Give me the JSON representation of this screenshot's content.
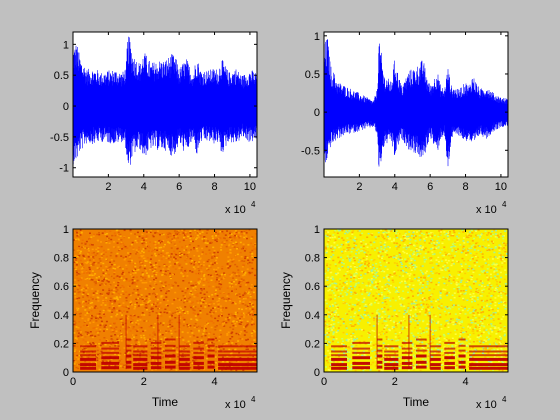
{
  "figure": {
    "background": "#c0c0c0"
  },
  "chart_data": [
    {
      "id": "waveform-top-left",
      "type": "line",
      "title": "",
      "xlabel": "",
      "ylabel": "",
      "xlim": [
        0,
        104000
      ],
      "ylim": [
        -1.15,
        1.2
      ],
      "xticks": [
        20000,
        40000,
        60000,
        80000,
        100000
      ],
      "xtick_labels": [
        "2",
        "4",
        "6",
        "8",
        "10"
      ],
      "x_exponent_label": "x 10",
      "x_exponent_power": "4",
      "yticks": [
        1,
        0.5,
        0,
        -0.5,
        -1
      ],
      "ytick_labels": [
        "1",
        "0.5",
        "0",
        "-0.5",
        "-1"
      ],
      "series": [
        {
          "color": "#0000ff",
          "envelope_x": [
            0,
            2000,
            4000,
            8000,
            12000,
            16000,
            20000,
            24000,
            28000,
            30000,
            31000,
            32000,
            34000,
            38000,
            40000,
            42000,
            44000,
            48000,
            52000,
            56000,
            58000,
            60000,
            62000,
            64000,
            66000,
            68000,
            70000,
            72000,
            76000,
            80000,
            82000,
            84000,
            88000,
            92000,
            96000,
            100000,
            104000
          ],
          "envelope_top": [
            0.95,
            1.05,
            0.8,
            0.6,
            0.62,
            0.55,
            0.58,
            0.6,
            0.55,
            0.65,
            1.2,
            1.1,
            0.85,
            0.7,
            0.9,
            0.8,
            0.7,
            0.75,
            0.75,
            0.85,
            0.8,
            0.6,
            0.7,
            0.78,
            0.65,
            0.55,
            0.85,
            0.6,
            0.58,
            0.62,
            0.6,
            0.78,
            0.55,
            0.62,
            0.5,
            0.6,
            0.55
          ],
          "envelope_bottom": [
            -0.95,
            -0.9,
            -0.75,
            -0.6,
            -0.62,
            -0.58,
            -0.6,
            -0.62,
            -0.58,
            -0.7,
            -1.15,
            -1.0,
            -0.8,
            -0.7,
            -0.85,
            -0.78,
            -0.7,
            -0.72,
            -0.72,
            -0.82,
            -0.78,
            -0.6,
            -0.72,
            -0.78,
            -0.65,
            -0.58,
            -0.82,
            -0.6,
            -0.58,
            -0.62,
            -0.6,
            -0.8,
            -0.58,
            -0.62,
            -0.52,
            -0.6,
            -0.55
          ]
        }
      ]
    },
    {
      "id": "waveform-top-right",
      "type": "line",
      "title": "",
      "xlabel": "",
      "ylabel": "",
      "xlim": [
        0,
        104000
      ],
      "ylim": [
        -0.85,
        1.05
      ],
      "xticks": [
        20000,
        40000,
        60000,
        80000,
        100000
      ],
      "xtick_labels": [
        "2",
        "4",
        "6",
        "8",
        "10"
      ],
      "x_exponent_label": "x 10",
      "x_exponent_power": "4",
      "yticks": [
        1,
        0.5,
        0,
        -0.5
      ],
      "ytick_labels": [
        "1",
        "0.5",
        "0",
        "-0.5"
      ],
      "series": [
        {
          "color": "#0000ff",
          "envelope_x": [
            0,
            2000,
            4000,
            8000,
            12000,
            16000,
            20000,
            24000,
            28000,
            30000,
            31000,
            32000,
            34000,
            38000,
            40000,
            42000,
            44000,
            48000,
            52000,
            56000,
            58000,
            60000,
            62000,
            64000,
            66000,
            68000,
            70000,
            72000,
            76000,
            80000,
            82000,
            84000,
            88000,
            92000,
            96000,
            100000,
            104000
          ],
          "envelope_top": [
            0.9,
            1.0,
            0.6,
            0.4,
            0.35,
            0.3,
            0.25,
            0.2,
            0.15,
            0.3,
            0.95,
            0.85,
            0.5,
            0.4,
            0.72,
            0.5,
            0.35,
            0.55,
            0.6,
            0.7,
            0.5,
            0.35,
            0.45,
            0.55,
            0.35,
            0.3,
            0.6,
            0.35,
            0.3,
            0.4,
            0.35,
            0.5,
            0.3,
            0.35,
            0.25,
            0.2,
            0.18
          ],
          "envelope_bottom": [
            -0.8,
            -0.6,
            -0.45,
            -0.35,
            -0.3,
            -0.28,
            -0.25,
            -0.22,
            -0.2,
            -0.3,
            -0.8,
            -0.7,
            -0.45,
            -0.38,
            -0.62,
            -0.45,
            -0.35,
            -0.5,
            -0.55,
            -0.65,
            -0.48,
            -0.32,
            -0.45,
            -0.55,
            -0.35,
            -0.3,
            -0.8,
            -0.35,
            -0.3,
            -0.4,
            -0.35,
            -0.5,
            -0.3,
            -0.35,
            -0.25,
            -0.2,
            -0.18
          ]
        }
      ]
    },
    {
      "id": "spectrogram-bottom-left",
      "type": "heatmap",
      "title": "",
      "xlabel": "Time",
      "ylabel": "Frequency",
      "xlim": [
        0,
        52000
      ],
      "ylim": [
        0,
        1
      ],
      "xticks": [
        0,
        20000,
        40000
      ],
      "xtick_labels": [
        "0",
        "2",
        "4"
      ],
      "x_exponent_label": "x 10",
      "x_exponent_power": "4",
      "yticks": [
        0,
        0.2,
        0.4,
        0.6,
        0.8,
        1
      ],
      "ytick_labels": [
        "0",
        "0.2",
        "0.4",
        "0.6",
        "0.8",
        "1"
      ],
      "background_color": "#f08000",
      "speckle_colors": [
        "#ff9900",
        "#e06000",
        "#ffb000",
        "#d04000",
        "#f07000"
      ],
      "harmonic_color": "#c00000",
      "harmonic_frequencies": [
        0.03,
        0.06,
        0.1,
        0.13,
        0.16,
        0.2
      ],
      "note_x": [
        [
          2000,
          6500
        ],
        [
          8000,
          13000
        ],
        [
          15000,
          16500
        ],
        [
          17000,
          21000
        ],
        [
          22000,
          25000
        ],
        [
          26000,
          29000
        ],
        [
          30000,
          33000
        ],
        [
          34000,
          37000
        ],
        [
          38000,
          40000
        ],
        [
          41000,
          52000
        ]
      ],
      "onset_x": [
        15000,
        24000,
        30000
      ]
    },
    {
      "id": "spectrogram-bottom-right",
      "type": "heatmap",
      "title": "",
      "xlabel": "Time",
      "ylabel": "Frequency",
      "xlim": [
        0,
        52000
      ],
      "ylim": [
        0,
        1
      ],
      "xticks": [
        0,
        20000,
        40000
      ],
      "xtick_labels": [
        "0",
        "2",
        "4"
      ],
      "x_exponent_label": "x 10",
      "x_exponent_power": "4",
      "yticks": [
        0,
        0.2,
        0.4,
        0.6,
        0.8,
        1
      ],
      "ytick_labels": [
        "0",
        "0.2",
        "0.4",
        "0.6",
        "0.8",
        "1"
      ],
      "background_color": "#f8f000",
      "speckle_colors": [
        "#ffff40",
        "#c8ff60",
        "#ffd000",
        "#a0f0a0",
        "#ffb000"
      ],
      "harmonic_color": "#c00000",
      "harmonic_frequencies": [
        0.03,
        0.06,
        0.1,
        0.13,
        0.16,
        0.2
      ],
      "note_x": [
        [
          2000,
          6500
        ],
        [
          8000,
          13000
        ],
        [
          15000,
          16500
        ],
        [
          17000,
          21000
        ],
        [
          22000,
          25000
        ],
        [
          26000,
          29000
        ],
        [
          30000,
          33000
        ],
        [
          34000,
          37000
        ],
        [
          38000,
          40000
        ],
        [
          41000,
          52000
        ]
      ],
      "onset_x": [
        15000,
        24000,
        30000
      ]
    }
  ]
}
